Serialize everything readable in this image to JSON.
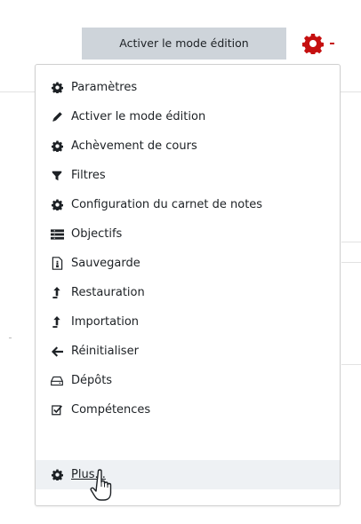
{
  "header": {
    "edit_button_label": "Activer le mode édition",
    "gear_icon": "gear-icon",
    "accent_color": "#c50f0f"
  },
  "menu": {
    "items": [
      {
        "label": "Paramètres",
        "icon": "gear-icon"
      },
      {
        "label": "Activer le mode édition",
        "icon": "pencil-icon"
      },
      {
        "label": "Achèvement de cours",
        "icon": "gear-icon"
      },
      {
        "label": "Filtres",
        "icon": "filter-icon"
      },
      {
        "label": "Configuration du carnet de notes",
        "icon": "gear-icon"
      },
      {
        "label": "Objectifs",
        "icon": "list-icon"
      },
      {
        "label": "Sauvegarde",
        "icon": "file-icon"
      },
      {
        "label": "Restauration",
        "icon": "upload-icon"
      },
      {
        "label": "Importation",
        "icon": "upload-icon"
      },
      {
        "label": "Réinitialiser",
        "icon": "arrow-left-icon"
      },
      {
        "label": "Dépôts",
        "icon": "hdd-icon"
      },
      {
        "label": "Compétences",
        "icon": "checkbox-icon"
      },
      {
        "label": "Plus...",
        "icon": "gear-icon"
      }
    ],
    "hovered_item": "Plus..."
  }
}
